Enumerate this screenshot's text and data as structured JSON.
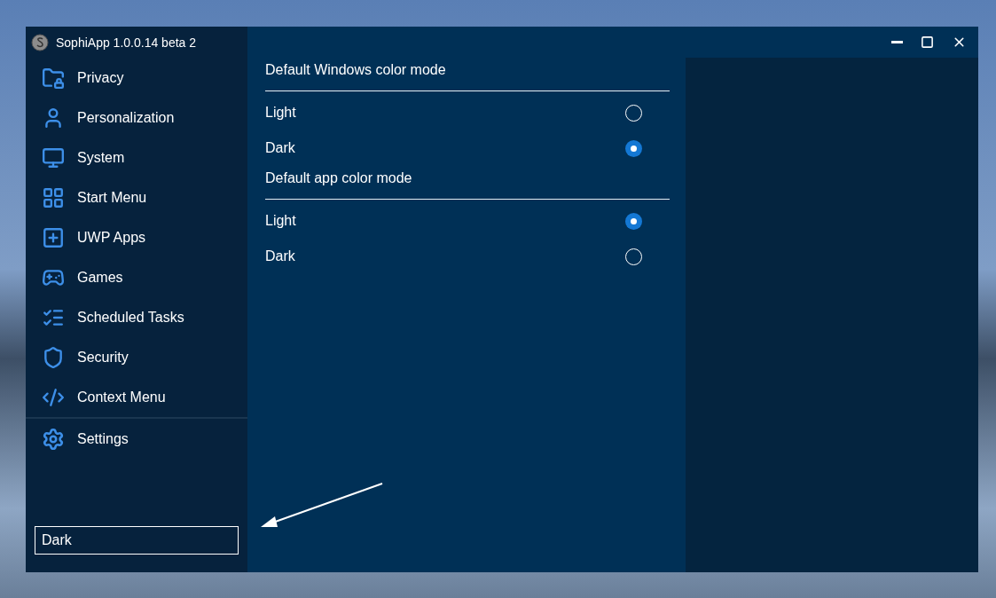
{
  "window": {
    "title": "SophiApp 1.0.0.14 beta 2"
  },
  "sidebar": {
    "items": [
      {
        "label": "Privacy",
        "selected": false
      },
      {
        "label": "Personalization",
        "selected": false
      },
      {
        "label": "System",
        "selected": false
      },
      {
        "label": "Start Menu",
        "selected": false
      },
      {
        "label": "UWP Apps",
        "selected": false
      },
      {
        "label": "Games",
        "selected": false
      },
      {
        "label": "Scheduled Tasks",
        "selected": false
      },
      {
        "label": "Security",
        "selected": false
      },
      {
        "label": "Context Menu",
        "selected": false
      }
    ],
    "footer_items": [
      {
        "label": "Settings",
        "selected": false
      }
    ],
    "search": {
      "value": "Dark"
    }
  },
  "groups": [
    {
      "heading": "Default Windows color mode",
      "options": [
        {
          "label": "Light",
          "selected": false
        },
        {
          "label": "Dark",
          "selected": true
        }
      ]
    },
    {
      "heading": "Default app color mode",
      "options": [
        {
          "label": "Light",
          "selected": true
        },
        {
          "label": "Dark",
          "selected": false
        }
      ]
    }
  ]
}
